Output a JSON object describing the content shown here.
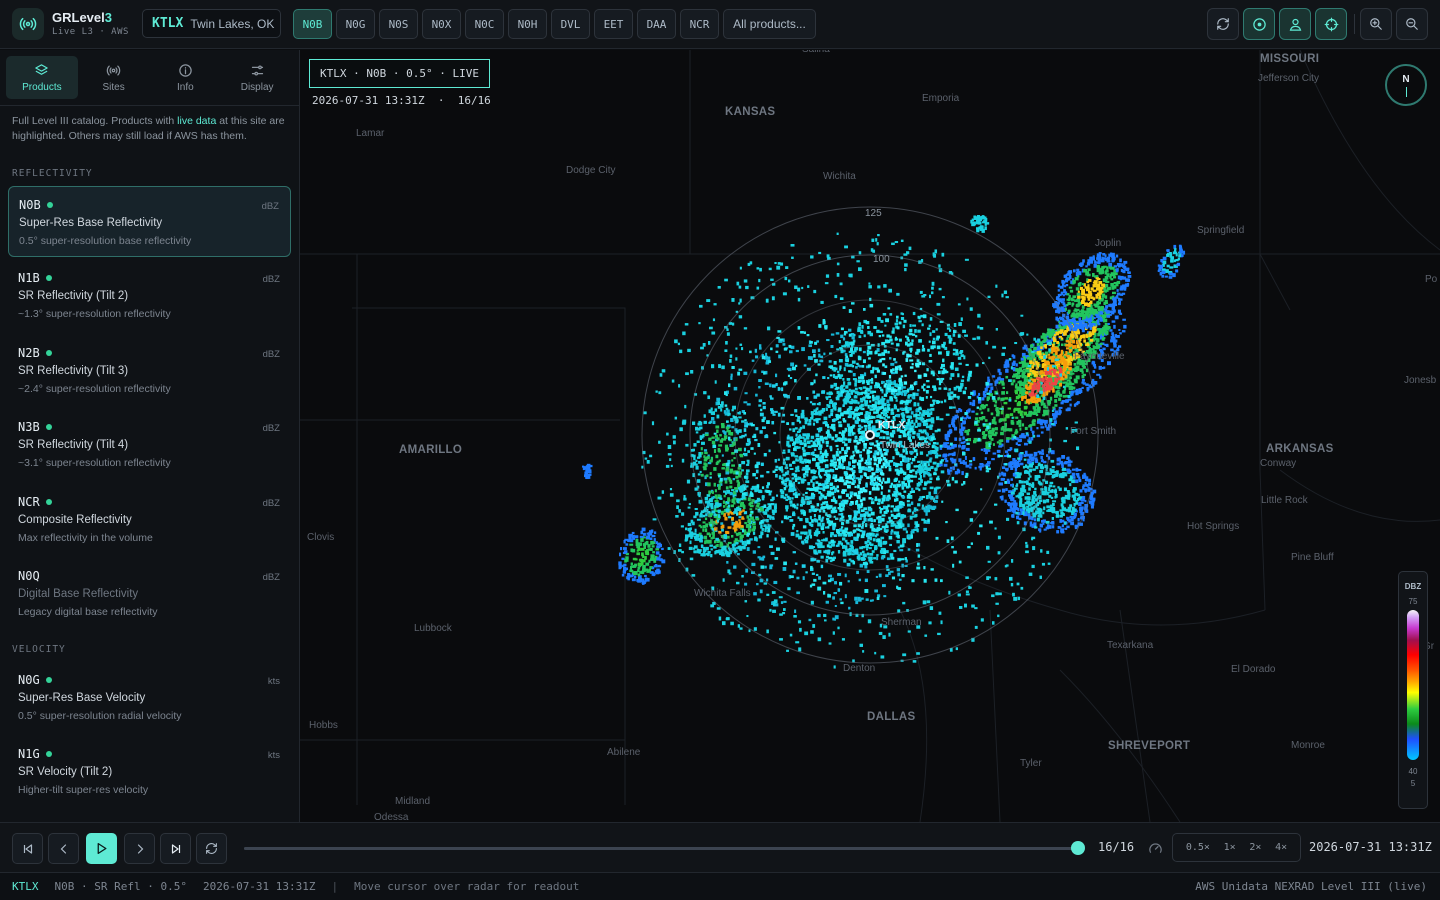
{
  "app": {
    "name_a": "GRLevel",
    "name_b": "3",
    "subtitle": "Live L3 · AWS"
  },
  "site": {
    "code": "KTLX",
    "name": "Twin Lakes, OK"
  },
  "product_buttons": [
    {
      "label": "N0B",
      "active": true
    },
    {
      "label": "N0G",
      "active": false
    },
    {
      "label": "N0S",
      "active": false
    },
    {
      "label": "N0X",
      "active": false
    },
    {
      "label": "N0C",
      "active": false
    },
    {
      "label": "N0H",
      "active": false
    },
    {
      "label": "DVL",
      "active": false
    },
    {
      "label": "EET",
      "active": false
    },
    {
      "label": "DAA",
      "active": false
    },
    {
      "label": "NCR",
      "active": false
    }
  ],
  "all_products_label": "All products...",
  "sidebar": {
    "tabs": [
      {
        "label": "Products",
        "icon": "layers-icon",
        "active": true
      },
      {
        "label": "Sites",
        "icon": "radio-signal-icon",
        "active": false
      },
      {
        "label": "Info",
        "icon": "info-icon",
        "active": false
      },
      {
        "label": "Display",
        "icon": "sliders-icon",
        "active": false
      }
    ],
    "note_a": "Full Level III catalog. Products with ",
    "note_highlight": "live data",
    "note_b": " at this site are highlighted. Others may still load if AWS has them.",
    "sections": [
      {
        "title": "REFLECTIVITY",
        "items": [
          {
            "code": "N0B",
            "name": "Super-Res Base Reflectivity",
            "desc": "0.5° super-resolution base reflectivity",
            "unit": "dBZ",
            "live": true,
            "selected": true
          },
          {
            "code": "N1B",
            "name": "SR Reflectivity (Tilt 2)",
            "desc": "~1.3° super-resolution reflectivity",
            "unit": "dBZ",
            "live": true,
            "selected": false
          },
          {
            "code": "N2B",
            "name": "SR Reflectivity (Tilt 3)",
            "desc": "~2.4° super-resolution reflectivity",
            "unit": "dBZ",
            "live": true,
            "selected": false
          },
          {
            "code": "N3B",
            "name": "SR Reflectivity (Tilt 4)",
            "desc": "~3.1° super-resolution reflectivity",
            "unit": "dBZ",
            "live": true,
            "selected": false
          },
          {
            "code": "NCR",
            "name": "Composite Reflectivity",
            "desc": "Max reflectivity in the volume",
            "unit": "dBZ",
            "live": true,
            "selected": false
          },
          {
            "code": "N0Q",
            "name": "Digital Base Reflectivity",
            "desc": "Legacy digital base reflectivity",
            "unit": "dBZ",
            "live": false,
            "selected": false
          }
        ]
      },
      {
        "title": "VELOCITY",
        "items": [
          {
            "code": "N0G",
            "name": "Super-Res Base Velocity",
            "desc": "0.5° super-resolution radial velocity",
            "unit": "kts",
            "live": true,
            "selected": false
          },
          {
            "code": "N1G",
            "name": "SR Velocity (Tilt 2)",
            "desc": "Higher-tilt super-res velocity",
            "unit": "kts",
            "live": true,
            "selected": false
          }
        ]
      }
    ]
  },
  "map": {
    "hud_title": "KTLX · N0B · 0.5° · LIVE",
    "hud_time": "2026-07-31 13:31Z  ·  16/16",
    "compass": "N",
    "range_rings": [
      "125",
      "100"
    ],
    "radar_label": "KTLX",
    "radar_sub": "Twin Lakes",
    "states": [
      "KANSAS",
      "MISSOURI",
      "ARKANSAS"
    ],
    "cities": [
      "Salina",
      "Emporia",
      "Jefferson City",
      "Lamar",
      "Dodge City",
      "Wichita",
      "Joplin",
      "Springfield",
      "Fayetteville",
      "Jonesb",
      "AMARILLO",
      "Fort Smith",
      "Conway",
      "Little Rock",
      "Clovis",
      "Hot Springs",
      "Pine Bluff",
      "Wichita Falls",
      "Lubbock",
      "Sherman",
      "Texarkana",
      "El Dorado",
      "Denton",
      "DALLAS",
      "Hobbs",
      "Abilene",
      "SHREVEPORT",
      "Monroe",
      "Tyler",
      "Midland",
      "Odessa",
      "Po",
      "Gr"
    ]
  },
  "legend": {
    "title": "DBZ",
    "max": "75",
    "low": "40",
    "min": "5"
  },
  "playback": {
    "frame_label": "16/16",
    "frame_fraction": 1.0,
    "speeds": [
      "0.5×",
      "1×",
      "2×",
      "4×"
    ],
    "time": "2026-07-31 13:31Z"
  },
  "status": {
    "site": "KTLX",
    "product": "N0B · SR Refl · 0.5°",
    "time": "2026-07-31 13:31Z",
    "sep": "|",
    "hint": "Move cursor over radar for readout",
    "source": "AWS Unidata NEXRAD Level III (live)"
  },
  "colors": {
    "accent": "#5eead4",
    "live_dot": "#34d399"
  }
}
